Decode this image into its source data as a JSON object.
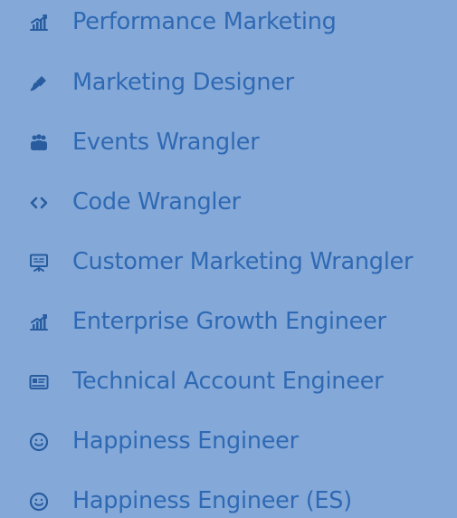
{
  "jobs": [
    {
      "label": "Performance Marketing",
      "icon": "growth-chart-icon"
    },
    {
      "label": "Marketing Designer",
      "icon": "paintbrush-icon"
    },
    {
      "label": "Events Wrangler",
      "icon": "group-people-icon"
    },
    {
      "label": "Code Wrangler",
      "icon": "code-brackets-icon"
    },
    {
      "label": "Customer Marketing Wrangler",
      "icon": "presentation-board-icon"
    },
    {
      "label": "Enterprise Growth Engineer",
      "icon": "growth-chart-icon"
    },
    {
      "label": "Technical Account Engineer",
      "icon": "id-card-icon"
    },
    {
      "label": "Happiness Engineer",
      "icon": "smiley-face-icon"
    },
    {
      "label": "Happiness Engineer (ES)",
      "icon": "smiley-face-icon"
    }
  ],
  "colors": {
    "background": "#84a9d8",
    "text": "#2f69b3",
    "icon": "#285c9f"
  }
}
